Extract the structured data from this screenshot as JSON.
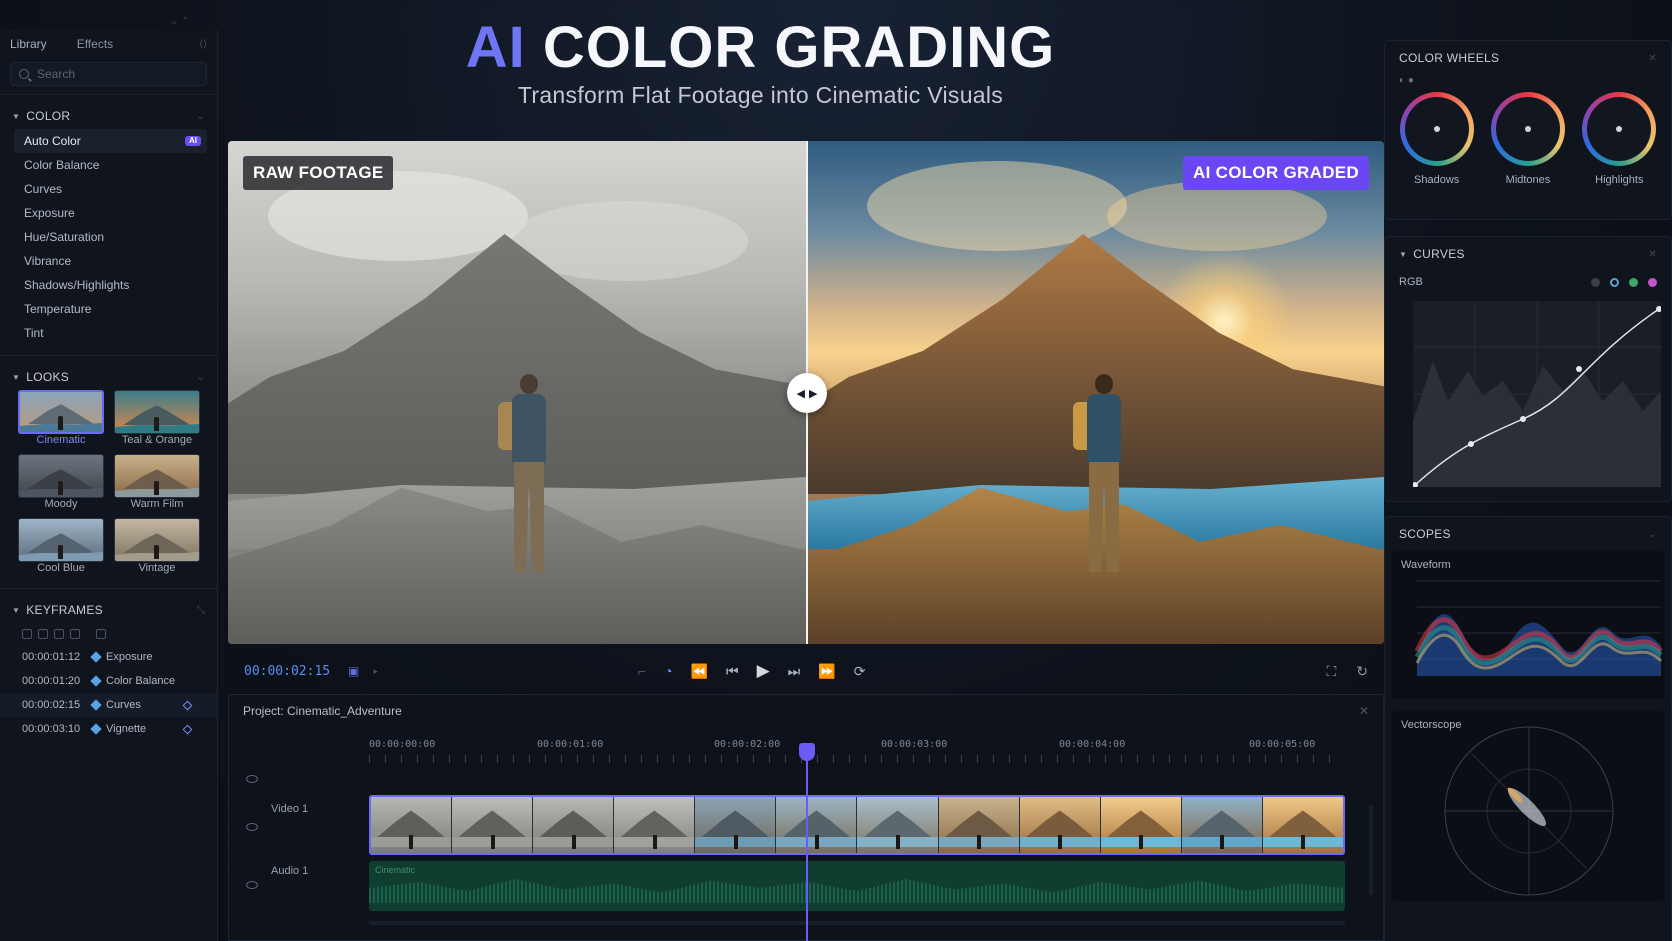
{
  "header": {
    "title_ai": "AI",
    "title_rest": "COLOR GRADING",
    "subtitle": "Transform Flat Footage into Cinematic Visuals",
    "accent_color": "#6f76f5"
  },
  "sidebar": {
    "tabs": [
      "Library",
      "Effects"
    ],
    "search_placeholder": "Search",
    "color_section": "COLOR",
    "color_items": [
      {
        "label": "Auto Color",
        "badge": "AI"
      },
      {
        "label": "Color Balance"
      },
      {
        "label": "Curves"
      },
      {
        "label": "Exposure"
      },
      {
        "label": "Hue/Saturation"
      },
      {
        "label": "Vibrance"
      },
      {
        "label": "Shadows/Highlights"
      },
      {
        "label": "Temperature"
      },
      {
        "label": "Tint"
      }
    ],
    "looks_section": "LOOKS",
    "looks": [
      "Cinematic",
      "Teal & Orange",
      "Moody",
      "Warm Film",
      "Cool Blue",
      "Vintage"
    ],
    "selected_look": "Cinematic",
    "keyframes_section": "KEYFRAMES",
    "keyframes": [
      {
        "time": "00:00:01:12",
        "name": "Exposure"
      },
      {
        "time": "00:00:01:20",
        "name": "Color Balance"
      },
      {
        "time": "00:00:02:15",
        "name": "Curves"
      },
      {
        "time": "00:00:03:10",
        "name": "Vignette"
      }
    ]
  },
  "viewer": {
    "left_tag": "RAW FOOTAGE",
    "right_tag": "AI COLOR GRADED",
    "split_position": 0.5
  },
  "transport": {
    "timecode": "00:00:02:15"
  },
  "timeline": {
    "project": "Project: Cinematic_Adventure",
    "ruler": [
      "00:00:00:00",
      "00:00:01:00",
      "00:00:02:00",
      "00:00:03:00",
      "00:00:04:00",
      "00:00:05:00"
    ],
    "tracks": {
      "video": "Video 1",
      "audio": "Audio 1"
    },
    "audio_clip": "Cinematic"
  },
  "right_panel": {
    "wheels_title": "COLOR WHEELS",
    "wheels": [
      "Shadows",
      "Midtones",
      "Highlights"
    ],
    "curves_title": "CURVES",
    "curves_channel": "RGB",
    "scopes_title": "SCOPES",
    "waveform_label": "Waveform",
    "vectorscope_label": "Vectorscope"
  }
}
